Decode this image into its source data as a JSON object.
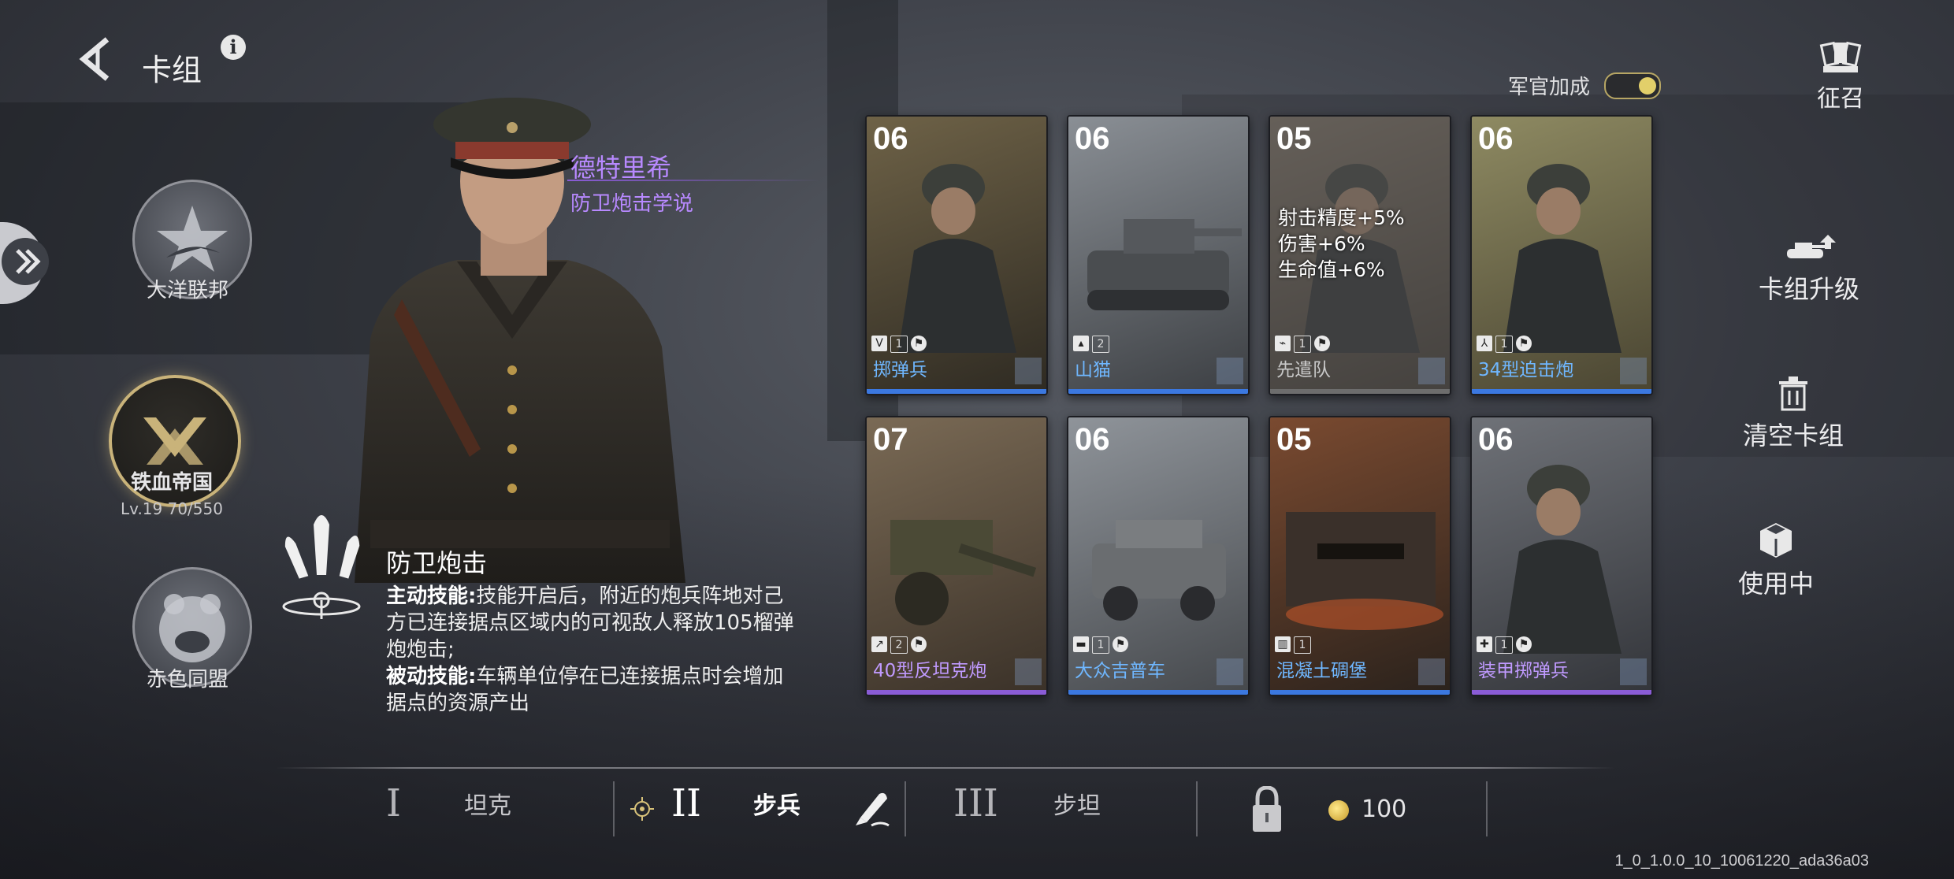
{
  "header": {
    "title": "卡组",
    "info": "i"
  },
  "factions": [
    {
      "label": "大洋联邦"
    },
    {
      "label": "铁血帝国",
      "level": "Lv.19",
      "xp": "70/550"
    },
    {
      "label": "赤色同盟"
    }
  ],
  "officer": {
    "name": "德特里希",
    "doctrine": "防卫炮击学说",
    "skill": {
      "title": "防卫炮击",
      "active_label": "主动技能:",
      "active_text": "技能开启后，附近的炮兵阵地对己方已连接据点区域内的可视敌人释放105榴弹炮炮击;",
      "passive_label": "被动技能:",
      "passive_text": "车辆单位停在已连接据点时会增加据点的资源产出"
    }
  },
  "officer_bonus": {
    "label": "军官加成",
    "enabled": true
  },
  "cards": [
    {
      "cost": "06",
      "name": "掷弹兵",
      "type_icon": "V",
      "count": "1",
      "flag": true,
      "rarity": "blue"
    },
    {
      "cost": "06",
      "name": "山猫",
      "type_icon": "▴",
      "count": "2",
      "flag": false,
      "rarity": "blue"
    },
    {
      "cost": "05",
      "name": "先遣队",
      "type_icon": "⌁",
      "count": "1",
      "flag": true,
      "rarity": "grey",
      "stats": [
        "射击精度+5%",
        "伤害+6%",
        "生命值+6%"
      ]
    },
    {
      "cost": "06",
      "name": "34型迫击炮",
      "type_icon": "⅄",
      "count": "1",
      "flag": true,
      "rarity": "blue"
    },
    {
      "cost": "07",
      "name": "40型反坦克炮",
      "type_icon": "↗",
      "count": "2",
      "flag": true,
      "rarity": "purple"
    },
    {
      "cost": "06",
      "name": "大众吉普车",
      "type_icon": "▬",
      "count": "1",
      "flag": true,
      "rarity": "blue"
    },
    {
      "cost": "05",
      "name": "混凝土碉堡",
      "type_icon": "▥",
      "count": "1",
      "flag": false,
      "rarity": "blue"
    },
    {
      "cost": "06",
      "name": "装甲掷弹兵",
      "type_icon": "✚",
      "count": "1",
      "flag": true,
      "rarity": "purple"
    }
  ],
  "right_menu": {
    "recruit": "征召",
    "upgrade": "卡组升级",
    "clear": "清空卡组",
    "in_use": "使用中"
  },
  "deck_tabs": [
    {
      "numeral": "I",
      "label": "坦克"
    },
    {
      "numeral": "II",
      "label": "步兵",
      "active": true
    },
    {
      "numeral": "III",
      "label": "步坦"
    }
  ],
  "currency": {
    "amount": "100"
  },
  "version": "1_0_1.0.0_10_10061220_ada36a03"
}
